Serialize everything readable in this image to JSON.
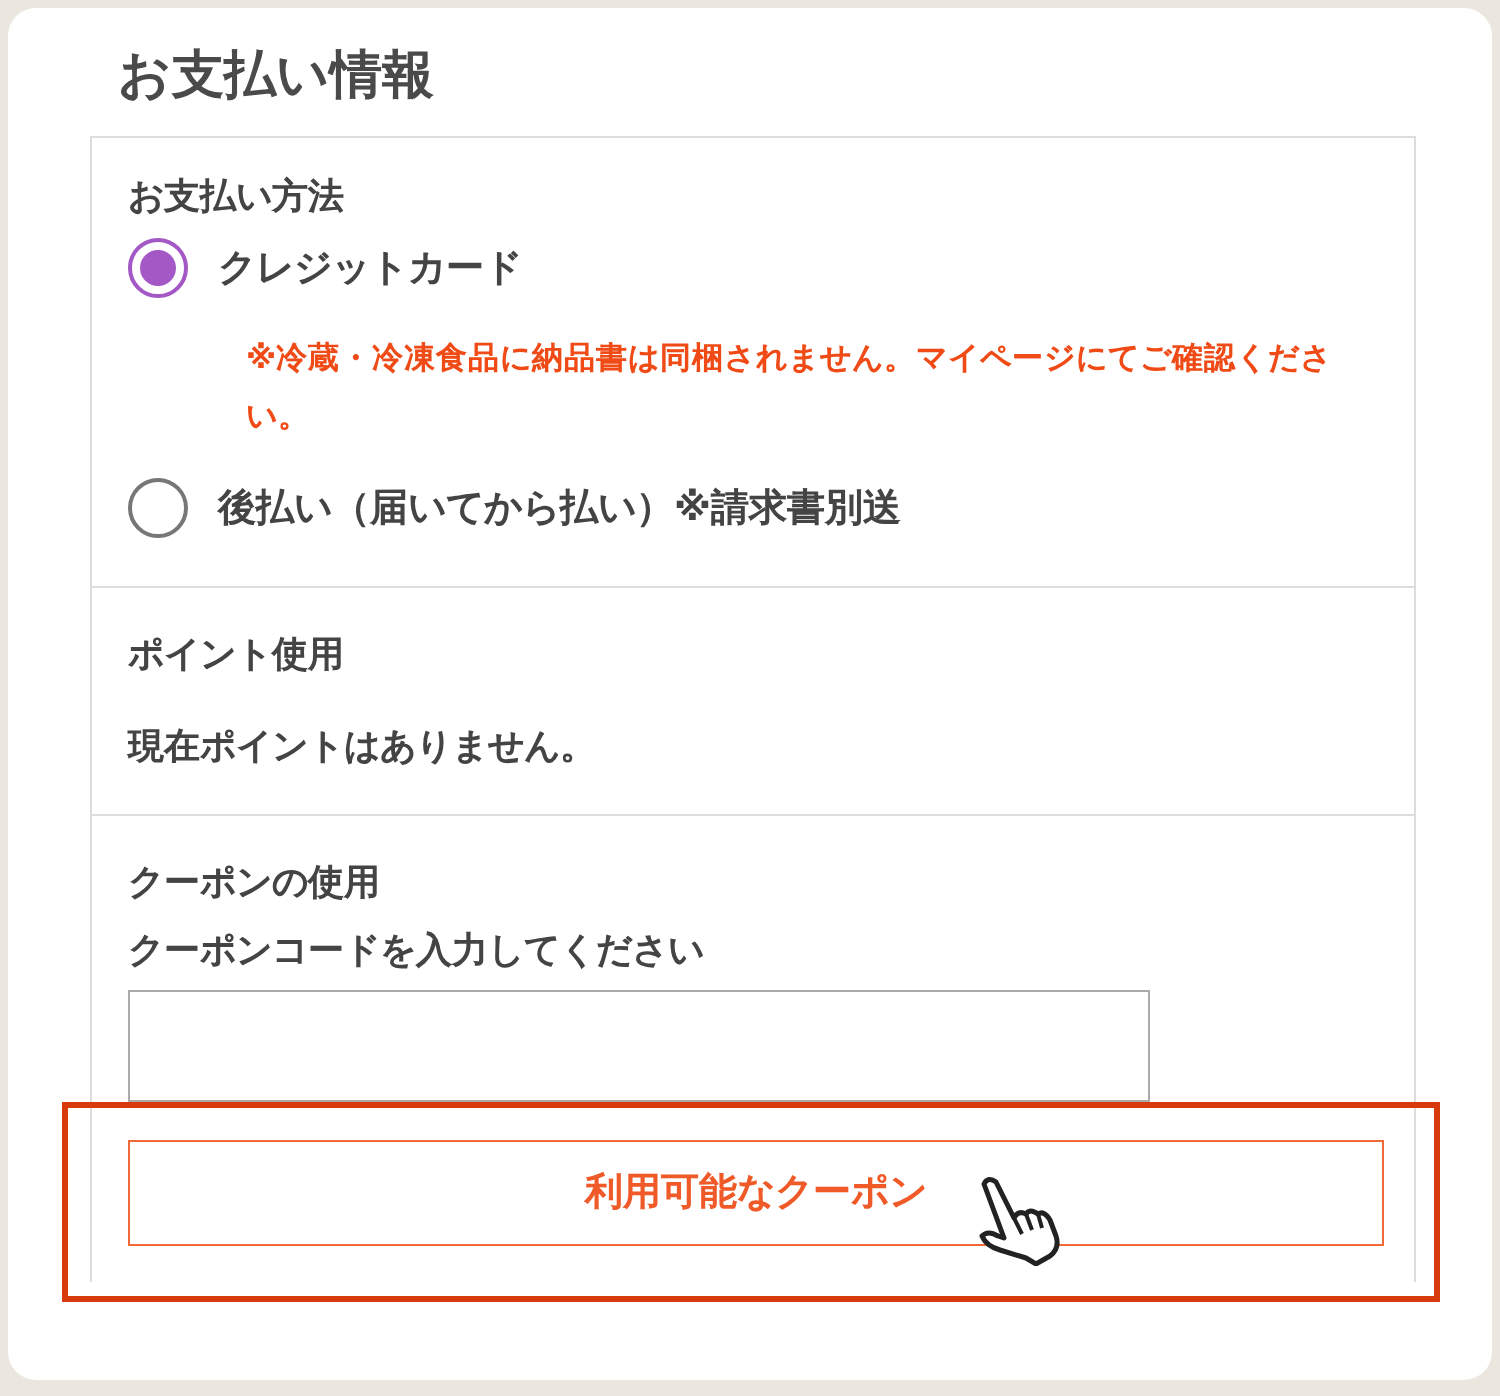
{
  "title": "お支払い情報",
  "payment": {
    "heading": "お支払い方法",
    "options": [
      {
        "label": "クレジットカード",
        "selected": true,
        "note": "※冷蔵・冷凍食品に納品書は同梱されません。マイページにてご確認ください。"
      },
      {
        "label": "後払い（届いてから払い）※請求書別送",
        "selected": false
      }
    ]
  },
  "points": {
    "heading": "ポイント使用",
    "message": "現在ポイントはありません。"
  },
  "coupon": {
    "heading": "クーポンの使用",
    "field_label": "クーポンコードを入力してください",
    "button": "利用可能なクーポン",
    "highlighted": true
  }
}
